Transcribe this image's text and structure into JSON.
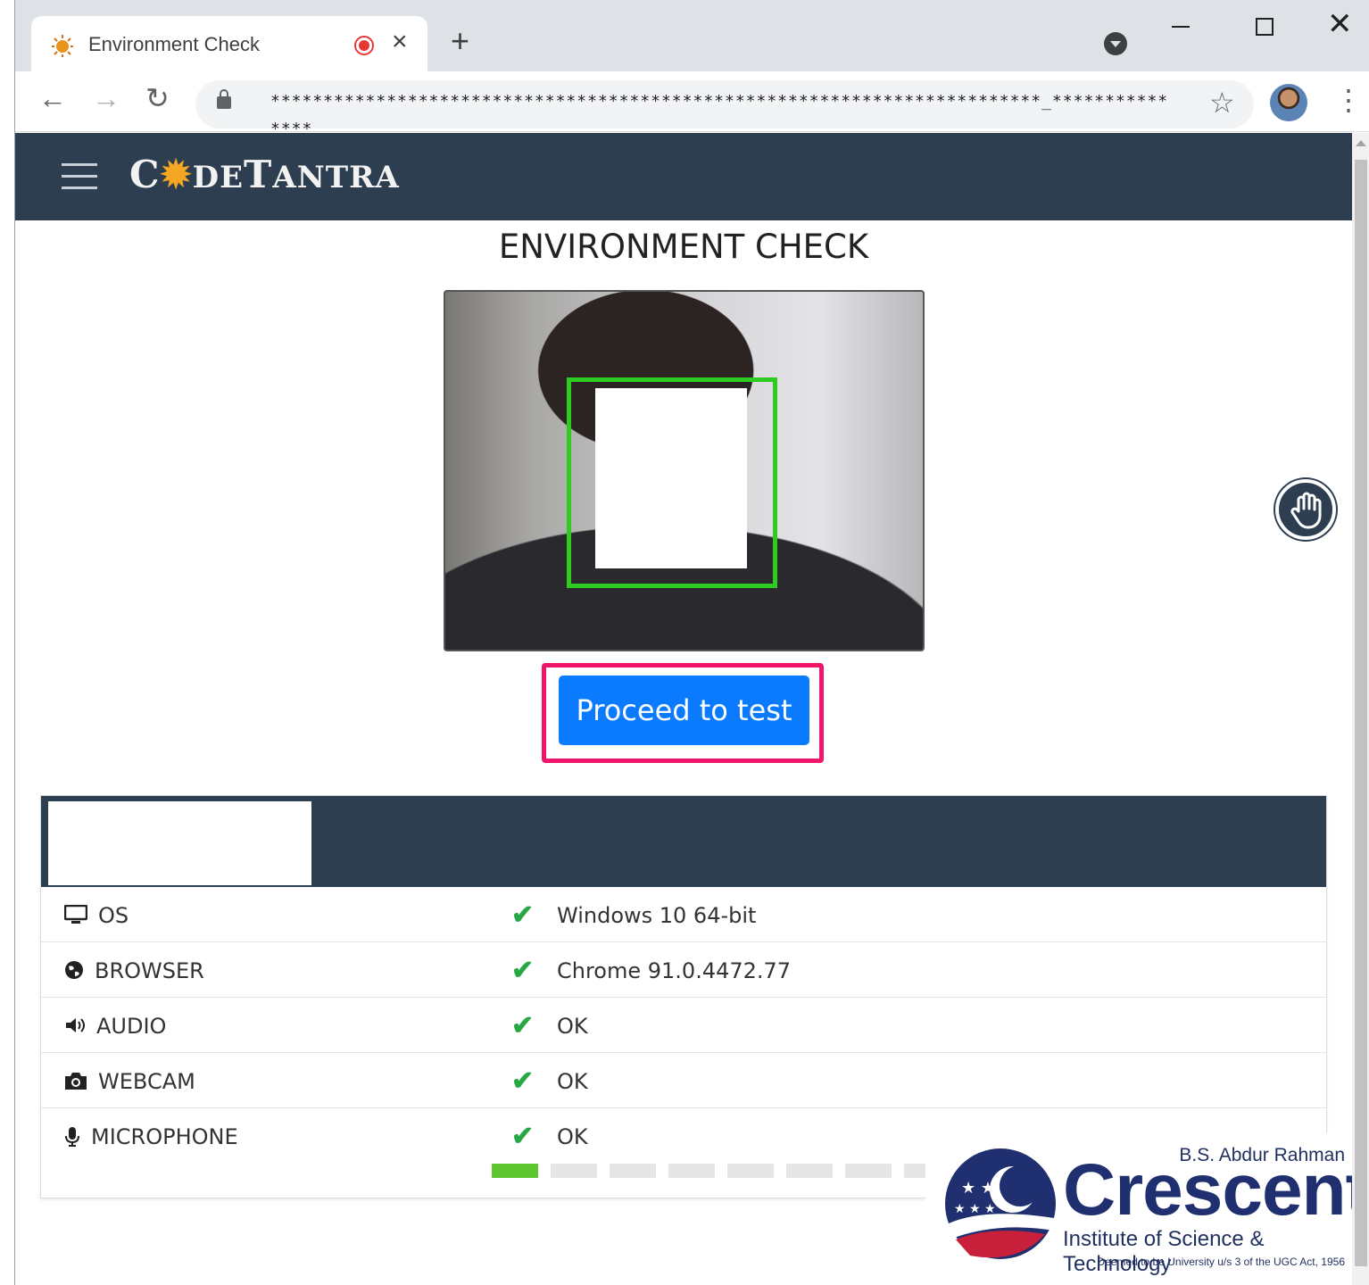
{
  "browser": {
    "tab_title": "Environment Check",
    "new_tab_symbol": "+",
    "url_masked": "*************************************************************************_***************"
  },
  "navbar": {
    "brand_first": "C",
    "brand_rest": "DE",
    "brand_second_initial": "T",
    "brand_second_rest": "ANTRA"
  },
  "page": {
    "heading": "ENVIRONMENT CHECK",
    "proceed_label": "Proceed to test"
  },
  "checks": [
    {
      "icon": "monitor-icon",
      "label": "OS",
      "status": "ok",
      "value": "Windows 10 64-bit"
    },
    {
      "icon": "globe-icon",
      "label": "BROWSER",
      "status": "ok",
      "value": "Chrome 91.0.4472.77"
    },
    {
      "icon": "speaker-icon",
      "label": "AUDIO",
      "status": "ok",
      "value": "OK"
    },
    {
      "icon": "camera-icon",
      "label": "WEBCAM",
      "status": "ok",
      "value": "OK"
    },
    {
      "icon": "microphone-icon",
      "label": "MICROPHONE",
      "status": "ok",
      "value": "OK"
    }
  ],
  "microphone_level": {
    "active_segments": 1,
    "total_segments": 8
  },
  "colors": {
    "navbar": "#2d3e50",
    "primary_button": "#0a7bff",
    "highlight_border": "#f0146b",
    "face_box": "#2ecc21",
    "check": "#28a745",
    "meter_active": "#5cc52f"
  },
  "logo": {
    "top_line": "B.S. Abdur Rahman",
    "name": "Crescent",
    "subtitle": "Institute of Science & Technology",
    "fine_print": "Deemed to be University u/s 3 of the UGC Act, 1956"
  }
}
